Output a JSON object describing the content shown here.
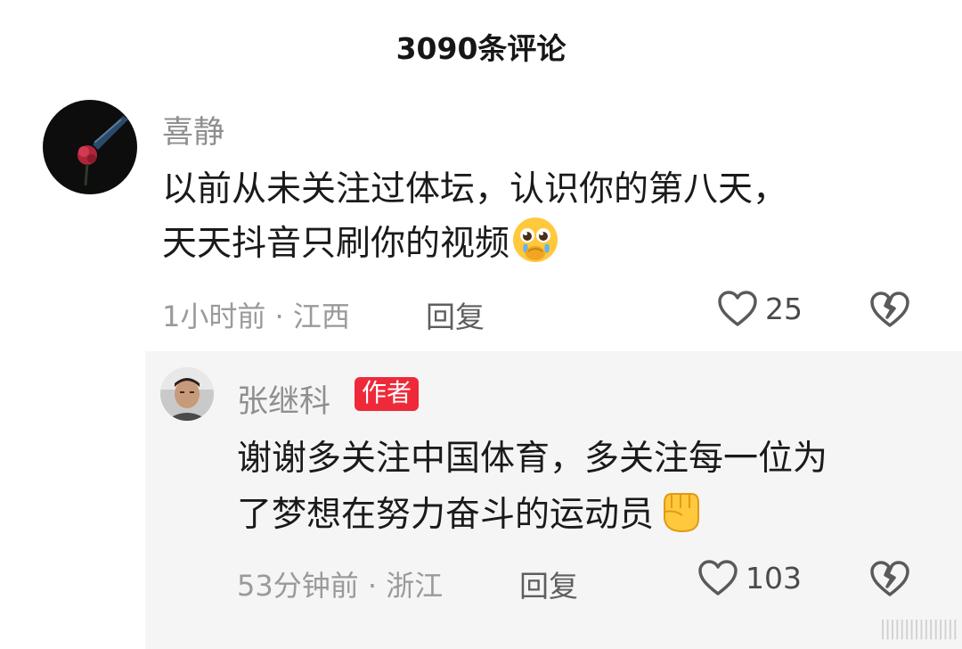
{
  "header": {
    "title": "3090条评论"
  },
  "comments": [
    {
      "username": "喜静",
      "text_line1": "以前从未关注过体坛，认识你的第八天，",
      "text_line2": "天天抖音只刷你的视频",
      "emoji": "pleading-face-emoji",
      "time": "1小时前 · 江西",
      "reply_label": "回复",
      "likes": "25",
      "avatar": "rose-avatar"
    }
  ],
  "reply": {
    "username": "张继科",
    "badge": "作者",
    "text_line1": "谢谢多关注中国体育，多关注每一位为",
    "text_line2": "了梦想在努力奋斗的运动员",
    "emoji": "raised-fist-emoji",
    "time": "53分钟前 · 浙江",
    "reply_label": "回复",
    "likes": "103",
    "avatar": "man-portrait-avatar"
  },
  "icons": {
    "like": "heart-outline-icon",
    "dislike": "broken-heart-icon"
  },
  "colors": {
    "badge_bg": "#ee2a3a",
    "reply_bg": "#f5f5f5",
    "meta_text": "#9a9a9a"
  }
}
